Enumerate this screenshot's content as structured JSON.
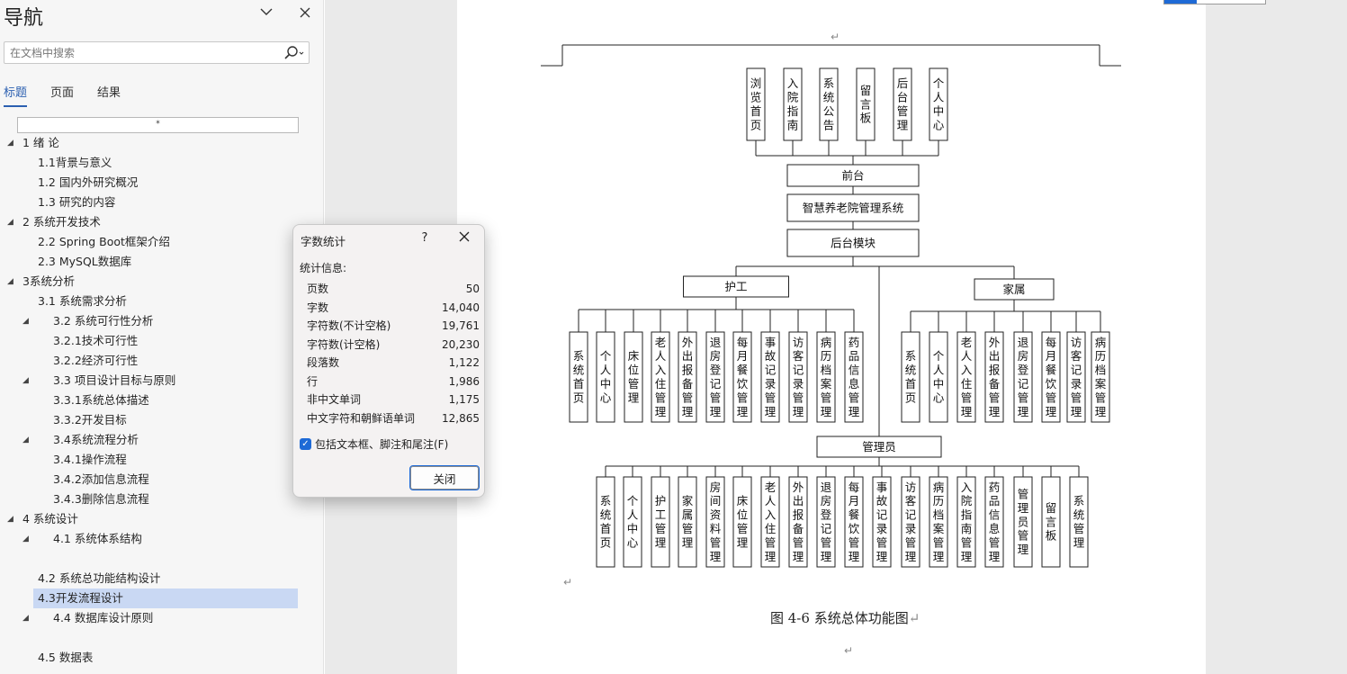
{
  "nav": {
    "title": "导航",
    "collapse_icon": "chevron-down-icon",
    "close_icon": "close-icon",
    "search_placeholder": "在文档中搜索",
    "tabs": [
      "标题",
      "页面",
      "结果"
    ],
    "heading_box": "*",
    "tree": [
      {
        "label": "1 绪 论",
        "level": 0,
        "expandable": true,
        "selected": false
      },
      {
        "label": "1.1背景与意义",
        "level": 1,
        "expandable": false,
        "selected": false
      },
      {
        "label": "1.2 国内外研究概况",
        "level": 1,
        "expandable": false,
        "selected": false
      },
      {
        "label": "1.3 研究的内容",
        "level": 1,
        "expandable": false,
        "selected": false
      },
      {
        "label": "2 系统开发技术",
        "level": 0,
        "expandable": true,
        "selected": false
      },
      {
        "label": "2.2 Spring Boot框架介绍",
        "level": 1,
        "expandable": false,
        "selected": false
      },
      {
        "label": "2.3 MySQL数据库",
        "level": 1,
        "expandable": false,
        "selected": false
      },
      {
        "label": "3系统分析",
        "level": 0,
        "expandable": true,
        "selected": false
      },
      {
        "label": "3.1 系统需求分析",
        "level": 1,
        "expandable": false,
        "selected": false
      },
      {
        "label": "3.2 系统可行性分析",
        "level": 1,
        "expandable": true,
        "selected": false
      },
      {
        "label": "3.2.1技术可行性",
        "level": 2,
        "expandable": false,
        "selected": false
      },
      {
        "label": "3.2.2经济可行性",
        "level": 2,
        "expandable": false,
        "selected": false
      },
      {
        "label": "3.3 项目设计目标与原则",
        "level": 1,
        "expandable": true,
        "selected": false
      },
      {
        "label": "3.3.1系统总体描述",
        "level": 2,
        "expandable": false,
        "selected": false
      },
      {
        "label": "3.3.2开发目标",
        "level": 2,
        "expandable": false,
        "selected": false
      },
      {
        "label": "3.4系统流程分析",
        "level": 1,
        "expandable": true,
        "selected": false
      },
      {
        "label": "3.4.1操作流程",
        "level": 2,
        "expandable": false,
        "selected": false
      },
      {
        "label": "3.4.2添加信息流程",
        "level": 2,
        "expandable": false,
        "selected": false
      },
      {
        "label": "3.4.3删除信息流程",
        "level": 2,
        "expandable": false,
        "selected": false
      },
      {
        "label": "4 系统设计",
        "level": 0,
        "expandable": true,
        "selected": false
      },
      {
        "label": "4.1 系统体系结构",
        "level": 1,
        "expandable": true,
        "selected": false
      },
      {
        "label": "",
        "level": 1,
        "expandable": false,
        "selected": false
      },
      {
        "label": "4.2 系统总功能结构设计",
        "level": 1,
        "expandable": false,
        "selected": false
      },
      {
        "label": "4.3开发流程设计",
        "level": 1,
        "expandable": false,
        "selected": true
      },
      {
        "label": "4.4 数据库设计原则",
        "level": 1,
        "expandable": true,
        "selected": false
      },
      {
        "label": "",
        "level": 1,
        "expandable": false,
        "selected": false
      },
      {
        "label": "4.5 数据表",
        "level": 1,
        "expandable": false,
        "selected": false
      }
    ]
  },
  "dialog": {
    "title": "字数统计",
    "help": "?",
    "close_icon": "close-icon",
    "section_label": "统计信息:",
    "stats": [
      {
        "label": "页数",
        "value": "50"
      },
      {
        "label": "字数",
        "value": "14,040"
      },
      {
        "label": "字符数(不计空格)",
        "value": "19,761"
      },
      {
        "label": "字符数(计空格)",
        "value": "20,230"
      },
      {
        "label": "段落数",
        "value": "1,122"
      },
      {
        "label": "行",
        "value": "1,986"
      },
      {
        "label": "非中文单词",
        "value": "1,175"
      },
      {
        "label": "中文字符和朝鲜语单词",
        "value": "12,865"
      }
    ],
    "checkbox_label": "包括文本框、脚注和尾注(F)",
    "checkbox_checked": true,
    "close_button": "关闭"
  },
  "diagram": {
    "front_items": [
      "浏览首页",
      "入院指南",
      "系统公告",
      "留言板",
      "后台管理",
      "个人中心"
    ],
    "front": "前台",
    "system": "智慧养老院管理系统",
    "backend": "后台模块",
    "nurse": "护工",
    "nurse_items": [
      "系统首页",
      "个人中心",
      "床位管理",
      "老人入住管理",
      "外出报备管理",
      "退房登记管理",
      "每月餐饮管理",
      "事故记录管理",
      "访客记录管理",
      "病历档案管理",
      "药品信息管理"
    ],
    "family": "家属",
    "family_items": [
      "系统首页",
      "个人中心",
      "老人入住管理",
      "外出报备管理",
      "退房登记管理",
      "每月餐饮管理",
      "访客记录管理",
      "病历档案管理"
    ],
    "admin": "管理员",
    "admin_items": [
      "系统首页",
      "个人中心",
      "护工管理",
      "家属管理",
      "房间资料管理",
      "床位管理",
      "老人入住管理",
      "外出报备管理",
      "退房登记管理",
      "每月餐饮管理",
      "事故记录管理",
      "访客记录管理",
      "病历档案管理",
      "入院指南管理",
      "药品信息管理",
      "管理员管理",
      "留言板",
      "系统管理"
    ]
  },
  "caption": "图 4-6  系统总体功能图",
  "para_mark": "↵",
  "colors": {
    "accent": "#1e6ad6",
    "selection": "#c9d8f3",
    "nav_bg": "#f6f6f6",
    "canvas_bg": "#eaeaea"
  }
}
